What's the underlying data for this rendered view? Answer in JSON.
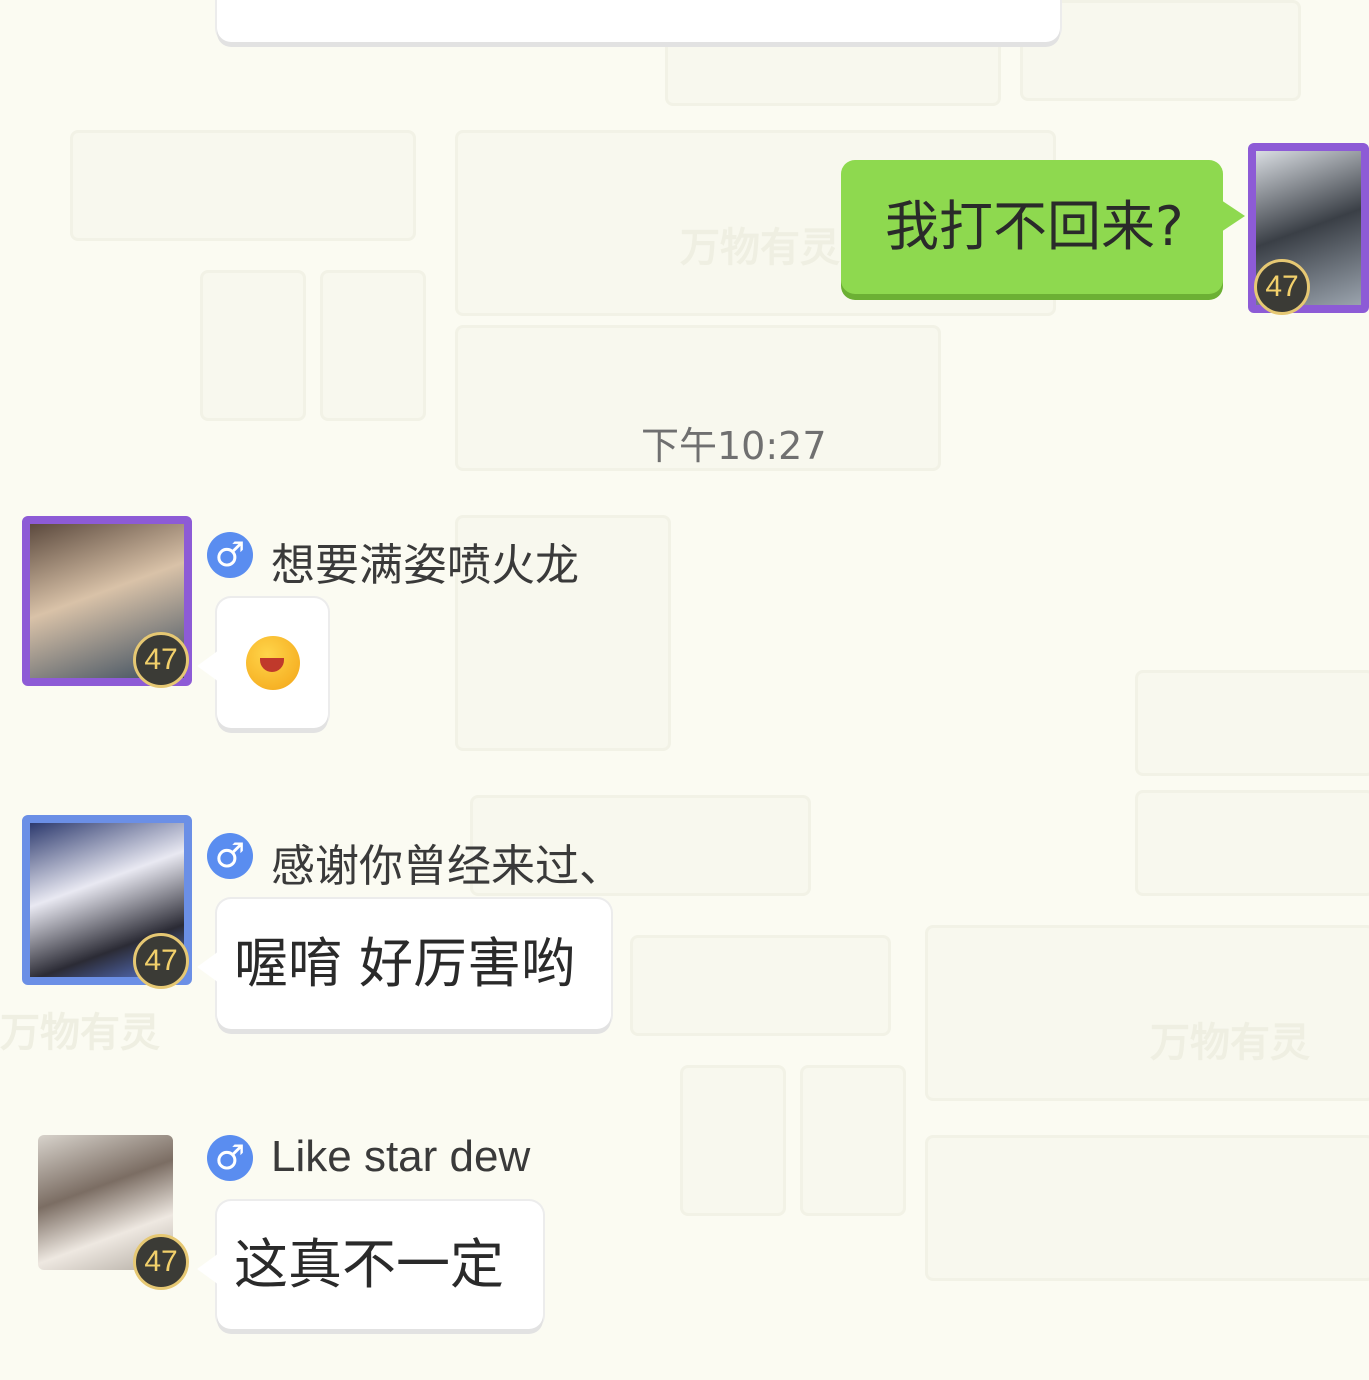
{
  "timestamp": "下午10:27",
  "messages": {
    "mine": {
      "text": "我打不回来?",
      "level": "47"
    },
    "m1": {
      "sender": "想要满姿喷火龙",
      "gender": "♂",
      "level": "47",
      "emoji_name": "sneeze-face-emoji"
    },
    "m2": {
      "sender": "感谢你曾经来过、",
      "gender": "♂",
      "level": "47",
      "text": "喔唷 好厉害哟"
    },
    "m3": {
      "sender": "Like star dew",
      "gender": "♂",
      "level": "47",
      "text": "这真不一定"
    }
  },
  "watermark": {
    "label": "万物有灵"
  },
  "colors": {
    "mine_bubble": "#8ed94f",
    "gender_badge": "#5a8df0",
    "level_badge": "#3b3b36"
  }
}
